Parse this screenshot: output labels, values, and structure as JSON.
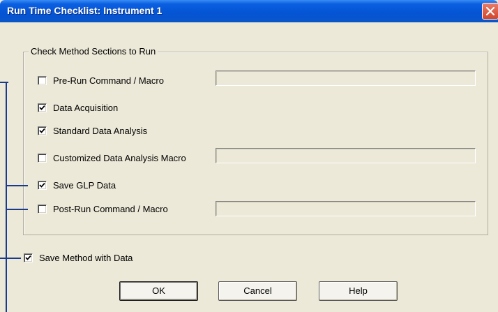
{
  "window": {
    "title": "Run Time Checklist: Instrument 1",
    "close_icon": "close-icon"
  },
  "group": {
    "legend": "Check Method Sections to Run",
    "items": [
      {
        "label": "Pre-Run Command / Macro",
        "checked": false,
        "has_field": true,
        "field_value": ""
      },
      {
        "label": "Data Acquisition",
        "checked": true,
        "has_field": false
      },
      {
        "label": "Standard Data Analysis",
        "checked": true,
        "has_field": false
      },
      {
        "label": "Customized Data Analysis Macro",
        "checked": false,
        "has_field": true,
        "field_value": ""
      },
      {
        "label": "Save GLP Data",
        "checked": true,
        "has_field": false
      },
      {
        "label": "Post-Run Command / Macro",
        "checked": false,
        "has_field": true,
        "field_value": ""
      }
    ]
  },
  "save_method": {
    "label": "Save Method with Data",
    "checked": true
  },
  "buttons": {
    "ok": "OK",
    "cancel": "Cancel",
    "help": "Help"
  },
  "colors": {
    "titlebar": "#0454d4",
    "dialog_bg": "#ece9d8",
    "callout_line": "#1a3a8c",
    "close_button": "#d2462b"
  }
}
